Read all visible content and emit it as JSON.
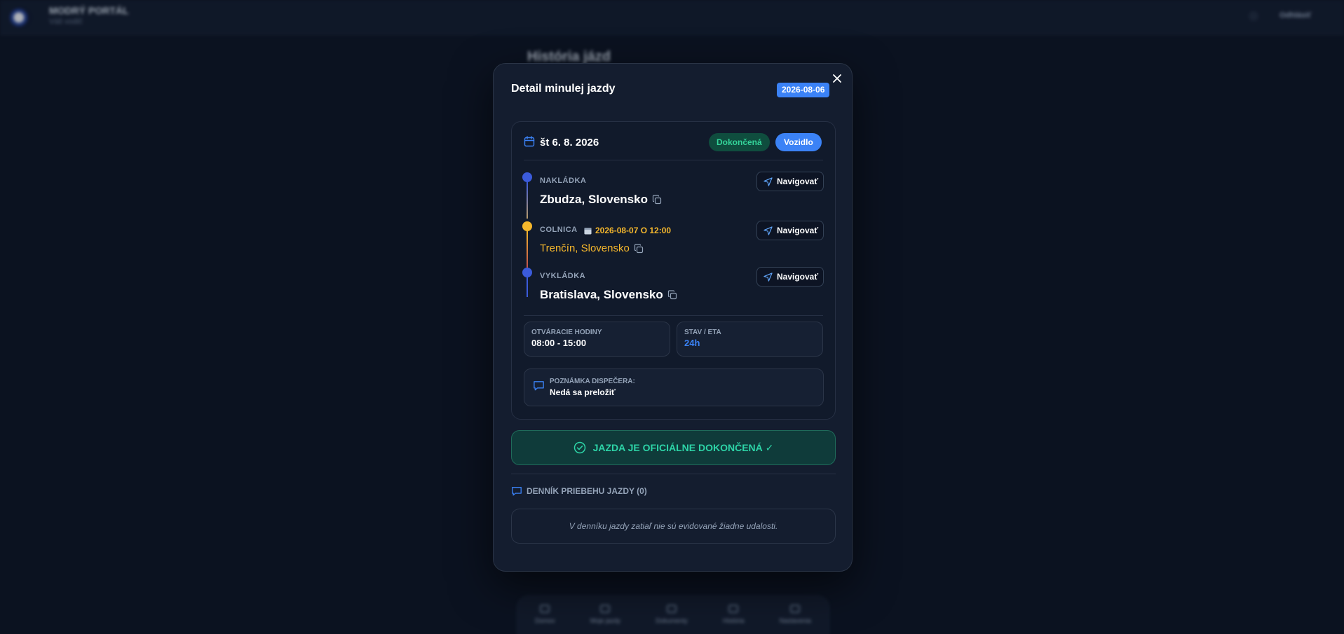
{
  "background": {
    "app_title": "MODRÝ PORTÁL",
    "app_subtitle": "Váš vodič",
    "logout_label": "Odhlásiť",
    "page_heading": "História jázd",
    "bottom_nav": [
      "Domov",
      "Moje jazdy",
      "Dokumenty",
      "História",
      "Nastavenia"
    ]
  },
  "modal": {
    "title": "Detail minulej jazdy",
    "date_badge": "2026-08-06",
    "close_icon": "close-icon",
    "card": {
      "date": "št 6. 8. 2026",
      "status_pill": "Dokončená",
      "vehicle_pill": "Vozidlo",
      "stops": [
        {
          "label": "NAKLÁDKA",
          "city": "Zbudza, Slovensko",
          "nav_label": "Navigovať",
          "color": "#3b5bdb"
        },
        {
          "label": "COLNICA",
          "datetime": "2026-08-07 O 12:00",
          "city": "Trenčín, Slovensko",
          "nav_label": "Navigovať",
          "color": "#f5b72c"
        },
        {
          "label": "VYKLÁDKA",
          "city": "Bratislava, Slovensko",
          "nav_label": "Navigovať",
          "color": "#3b5bdb"
        }
      ],
      "opening_hours": {
        "label": "OTVÁRACIE HODINY",
        "value": "08:00 - 15:00"
      },
      "status_eta": {
        "label": "STAV / ETA",
        "value": "24h"
      },
      "dispatcher_note": {
        "label": "POZNÁMKA DISPEČERA:",
        "value": "Nedá sa preložiť"
      }
    },
    "finished_banner": "JAZDA JE OFICIÁLNE DOKONČENÁ ✓",
    "log": {
      "title": "DENNÍK PRIEBEHU JAZDY (0)",
      "empty_text": "V denníku jazdy zatiaľ nie sú evidované žiadne udalosti."
    }
  },
  "colors": {
    "accent": "#3b82f6",
    "success": "#34d399",
    "warning": "#f5b72c",
    "modal_bg": "#141d2f"
  }
}
